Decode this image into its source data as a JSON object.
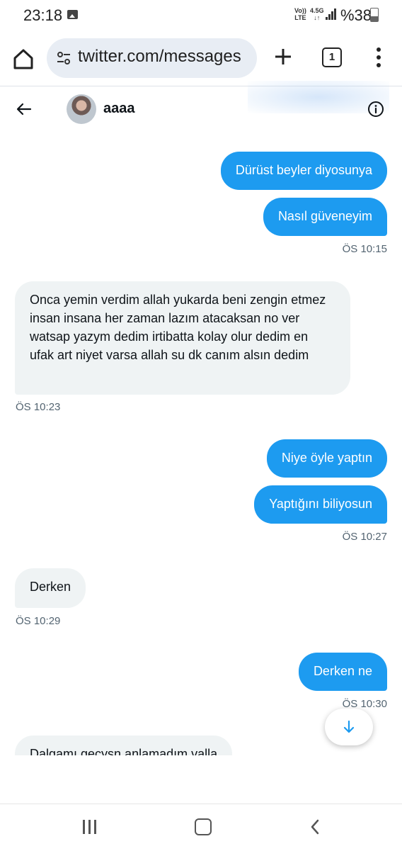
{
  "status": {
    "time": "23:18",
    "volte": "Vo)) LTE",
    "network": "4.5G",
    "battery": "%38"
  },
  "browser": {
    "url": "twitter.com/messages",
    "tab_count": "1"
  },
  "chat": {
    "name": "aaaa"
  },
  "messages": [
    {
      "dir": "out",
      "text": "Dürüst beyler diyosunya"
    },
    {
      "dir": "out",
      "text": "Nasıl güveneyim",
      "time": "ÖS 10:15"
    },
    {
      "dir": "in",
      "text": "Onca yemin verdim allah yukarda beni zengin etmez insan insana her zaman lazım atacaksan no ver watsap yazym dedim irtibatta kolay olur dedim en ufak art niyet varsa allah su dk canım alsın dedim",
      "time": "ÖS 10:23"
    },
    {
      "dir": "out",
      "text": "Niye öyle yaptın"
    },
    {
      "dir": "out",
      "text": "Yaptığını biliyosun",
      "time": "ÖS 10:27"
    },
    {
      "dir": "in",
      "text": "Derken",
      "time": "ÖS 10:29"
    },
    {
      "dir": "out",
      "text": "Derken ne",
      "time": "ÖS 10:30"
    },
    {
      "dir": "in",
      "text": "Dalgamı geçysn anlamadım valla"
    }
  ],
  "colors": {
    "accent": "#1d9bf0",
    "incoming_bg": "#eff3f4",
    "url_bg": "#e8edf4"
  }
}
